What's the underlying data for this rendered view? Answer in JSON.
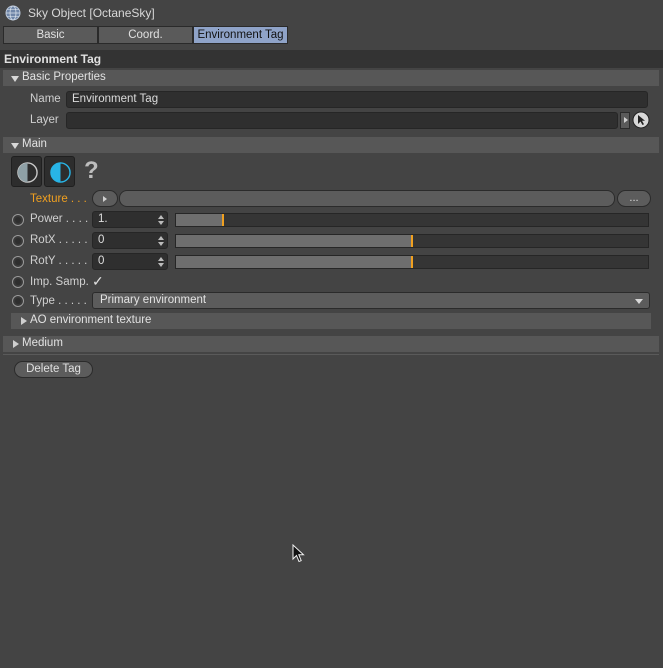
{
  "window": {
    "title": "Sky Object [OctaneSky]"
  },
  "tabs": [
    {
      "label": "Basic",
      "active": false
    },
    {
      "label": "Coord.",
      "active": false
    },
    {
      "label": "Environment Tag",
      "active": true
    }
  ],
  "section_title": "Environment Tag",
  "basic_properties": {
    "header": "Basic Properties",
    "name_label": "Name",
    "name_value": "Environment Tag",
    "layer_label": "Layer",
    "layer_value": ""
  },
  "main": {
    "header": "Main",
    "help_glyph": "?",
    "texture_label": "Texture . . .",
    "texture_more": "...",
    "power": {
      "label": "Power . . . .",
      "value": "1.",
      "slider_fraction": 0.1
    },
    "rotx": {
      "label": "RotX . . . . .",
      "value": "0",
      "slider_fraction": 0.5
    },
    "roty": {
      "label": "RotY . . . . .",
      "value": "0",
      "slider_fraction": 0.5
    },
    "imp_samp": {
      "label": "Imp. Samp.",
      "checked": true,
      "check_glyph": "✓"
    },
    "type": {
      "label": "Type . . . . .",
      "value": "Primary environment"
    },
    "ao_header": "AO environment texture"
  },
  "medium": {
    "header": "Medium"
  },
  "delete_button": "Delete Tag",
  "colors": {
    "accent_texture": "#f0a020",
    "slider_knob": "#f0a020",
    "active_tab": "#8fa3c8",
    "icon_cyan": "#28b4e6"
  }
}
